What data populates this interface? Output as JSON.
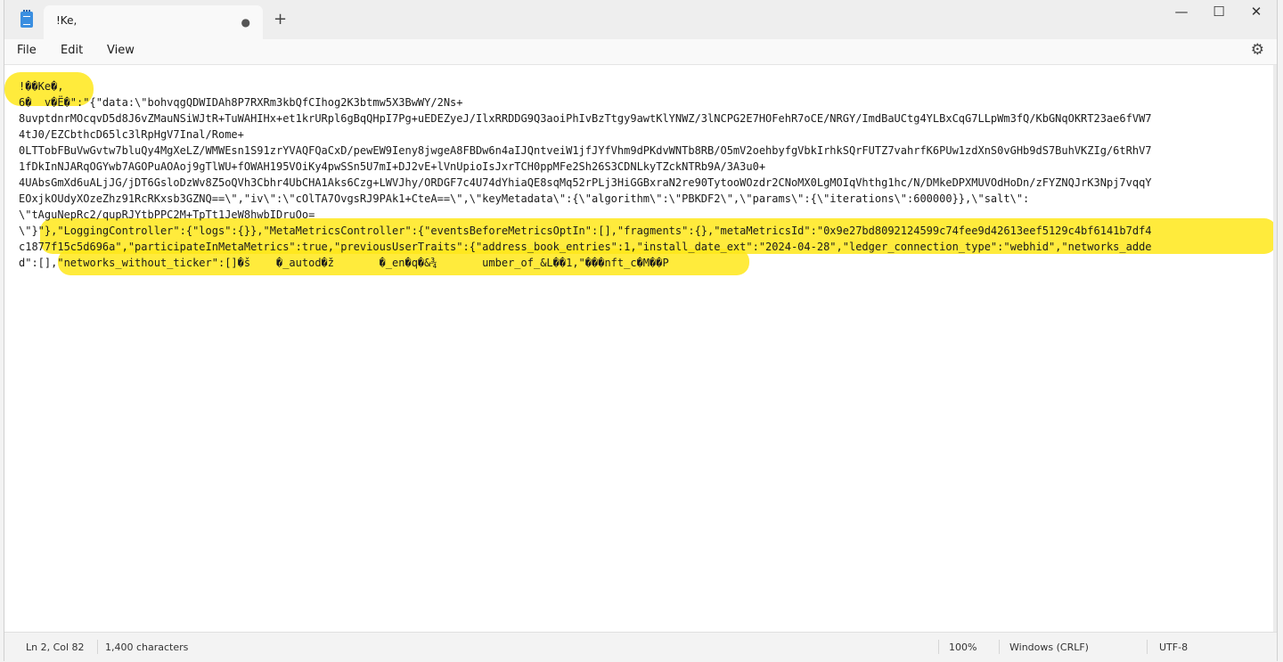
{
  "tab": {
    "title": "!Ke,"
  },
  "menu": {
    "file": "File",
    "edit": "Edit",
    "view": "View"
  },
  "editor": {
    "lines": [
      "!��Ke�,",
      "6�  v�Ë�\":\"{\"data:\\\"bohvqgQDWIDAh8P7RXRm3kbQfCIhog2K3btmw5X3BwWY/2Ns+",
      "8uvptdnrMOcqvD5d8J6vZMauNSiWJtR+TuWAHIHx+et1krURpl6gBqQHpI7Pg+uEDEZyeJ/IlxRRDDG9Q3aoiPhIvBzTtgy9awtKlYNWZ/3lNCPG2E7HOFehR7oCE/NRGY/ImdBaUCtg4YLBxCqG7LLpWm3fQ/KbGNqOKRT23ae6fVW7",
      "4tJ0/EZCbthcD65lc3lRpHgV7Inal/Rome+",
      "0LTTobFBuVwGvtw7bluQy4MgXeLZ/WMWEsn1S91zrYVAQFQaCxD/pewEW9Ieny8jwgeA8FBDw6n4aIJQntveiW1jfJYfVhm9dPKdvWNTb8RB/O5mV2oehbyfgVbkIrhkSQrFUTZ7vahrfK6PUw1zdXnS0vGHb9dS7BuhVKZIg/6tRhV7",
      "1fDkInNJARqOGYwb7AGOPuAOAoj9gTlWU+fOWAH195VOiKy4pwSSn5U7mI+DJ2vE+lVnUpioIsJxrTCH0ppMFe2Sh26S3CDNLkyTZckNTRb9A/3A3u0+",
      "4UAbsGmXd6uALjJG/jDT6GsloDzWv8Z5oQVh3Cbhr4UbCHA1Aks6Czg+LWVJhy/ORDGF7c4U74dYhiaQE8sqMq52rPLj3HiGGBxraN2re90TytooWOzdr2CNoMX0LgMOIqVhthg1hc/N/DMkeDPXMUVOdHoDn/zFYZNQJrK3Npj7vqqY",
      "EOxjkOUdyXOzeZhz91RcRKxsb3GZNQ==\\\",\"iv\\\":\\\"cOlTA7OvgsRJ9PAk1+CteA==\\\",\\\"keyMetadata\\\":{\\\"algorithm\\\":\\\"PBKDF2\\\",\\\"params\\\":{\\\"iterations\\\":600000}},\\\"salt\\\":",
      "\\\"tAguNepRc2/qupRJYtbPPC2M+TpTt1JeW8hwbIDruOo=",
      "\\\"}\"},\"LoggingController\":{\"logs\":{}},\"MetaMetricsController\":{\"eventsBeforeMetricsOptIn\":[],\"fragments\":{},\"metaMetricsId\":\"0x9e27bd8092124599c74fee9d42613eef5129c4bf6141b7df4",
      "c1877f15c5d696a\",\"participateInMetaMetrics\":true,\"previousUserTraits\":{\"address_book_entries\":1,\"install_date_ext\":\"2024-04-28\",\"ledger_connection_type\":\"webhid\",\"networks_adde",
      "d\":[],\"networks_without_ticker\":[]�š    �_autod�ž       �_en�q�&¾       umber_of_&L��1,\"���nft_c�M��P"
    ]
  },
  "status": {
    "position": "Ln 2, Col 82",
    "characters": "1,400 characters",
    "zoom": "100%",
    "line_ending": "Windows (CRLF)",
    "encoding": "UTF-8"
  }
}
